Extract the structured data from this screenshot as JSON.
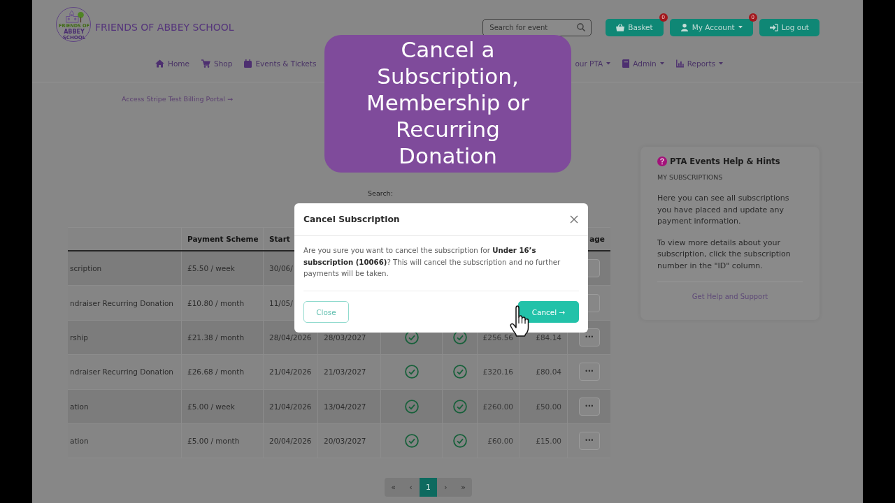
{
  "header": {
    "logo": {
      "lines": [
        "FRIENDS OF",
        "ABBEY",
        "SCHOOL"
      ]
    },
    "site_title": "FRIENDS OF ABBEY SCHOOL",
    "search": {
      "placeholder": "Search for event"
    },
    "buttons": [
      {
        "label": "Basket",
        "badge": "0",
        "caret": false
      },
      {
        "label": "My Account",
        "badge": "0",
        "caret": true
      },
      {
        "label": "Log out",
        "caret": false
      }
    ]
  },
  "nav": [
    {
      "label": "Home",
      "dropdown": false
    },
    {
      "label": "Shop",
      "dropdown": false
    },
    {
      "label": "Events & Tickets",
      "dropdown": false
    },
    {
      "label": "our PTA",
      "dropdown": true
    },
    {
      "label": "Admin",
      "dropdown": true
    },
    {
      "label": "Reports",
      "dropdown": true
    }
  ],
  "caption": "Cancel a Subscription, Membership or Recurring Donation",
  "billing_link": "Access Stripe Test Billing Portal →",
  "search_label": "Search:",
  "table": {
    "columns": [
      null,
      "Payment Scheme",
      "Start",
      null,
      null,
      null,
      null,
      null,
      "age"
    ],
    "rows": [
      [
        "scription",
        "£5.50 / week",
        "30/06/"
      ],
      [
        "ndraiser Recurring Donation",
        "£10.80 / month",
        "11/05/"
      ],
      [
        "rship",
        "£21.38 / month",
        "28/04/2026",
        "28/03/2027",
        true,
        true,
        "£256.56",
        "£84.14",
        "•••"
      ],
      [
        "ndraiser Recurring Donation",
        "£26.68 / month",
        "21/04/2026",
        "21/03/2027",
        true,
        true,
        "£320.16",
        "£80.04",
        "•••"
      ],
      [
        "ation",
        "£5.00 / week",
        "21/04/2026",
        "13/04/2027",
        true,
        true,
        "£260.00",
        "£50.00",
        "•••"
      ],
      [
        "ation",
        "£5.00 / month",
        "20/04/2026",
        "20/03/2027",
        true,
        true,
        "£60.00",
        "£15.00",
        "•••"
      ]
    ]
  },
  "pagination": [
    {
      "label": "«",
      "selected": false
    },
    {
      "label": "‹",
      "selected": false
    },
    {
      "label": "1",
      "selected": true
    },
    {
      "label": "›",
      "selected": false
    },
    {
      "label": "»",
      "selected": false
    }
  ],
  "help_card": {
    "title": "PTA Events Help & Hints",
    "subtitle": "MY SUBSCRIPTIONS",
    "paragraphs": [
      "Here you can see all subscriptions you have placed and update any payment information.",
      "To view more details about your subscription, click the subscription number in the \"ID\" column."
    ],
    "link": "Get Help and Support"
  },
  "modal": {
    "title": "Cancel Subscription",
    "message": "Are you sure you want to cancel the subscription for **Under 16’s subscription (10066)**? This will cancel the subscription and no further payments will be taken.",
    "buttons": [
      {
        "label": "Close",
        "kind": "secondary"
      },
      {
        "label": "Cancel →",
        "kind": "primary"
      }
    ]
  }
}
